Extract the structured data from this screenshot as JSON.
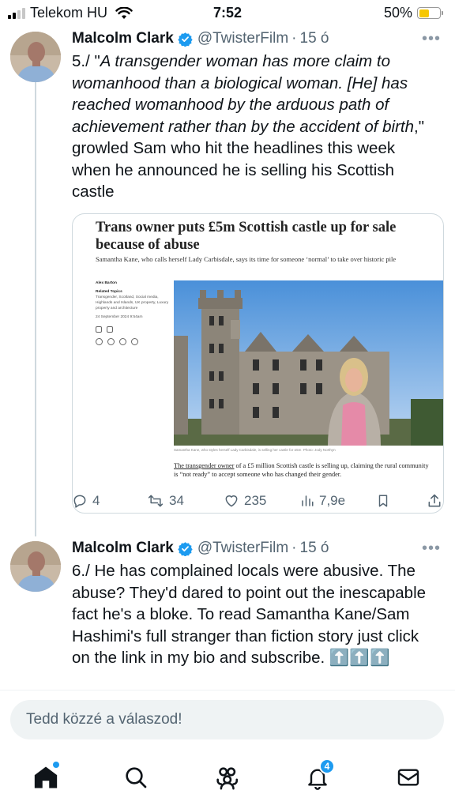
{
  "status_bar": {
    "carrier": "Telekom HU",
    "time": "7:52",
    "battery_percent": "50%",
    "battery_level": 0.5,
    "signal_bars": 2
  },
  "tweets": [
    {
      "author_name": "Malcolm Clark",
      "handle": "@TwisterFilm",
      "separator": "·",
      "age": "15 ó",
      "text_prefix": "5./ \"",
      "text_italic": "A transgender woman has more claim to womanhood than a biological woman. [He] has reached womanhood by the arduous path of achievement rather than by the accident of birth",
      "text_suffix": ",\" growled Sam who hit the headlines this week when he announced he is selling his Scottish castle",
      "card": {
        "headline": "Trans owner puts £5m Scottish castle up for sale because of abuse",
        "subheadline": "Samantha Kane, who calls herself Lady Carbisdale, says its time for someone ‘normal’ to take over historic pile",
        "author": "Alex Barton",
        "related_topics_label": "Related Topics",
        "related_topics": "Transgender, Scotland, Social media, Highlands and Islands, UK property, Luxury property and architecture",
        "date": "24 September 2024 9:54am",
        "photo_caption": "Samantha Kane, who styles herself Lady Carbisdale, is selling her castle for £5m",
        "photo_credit": "Photo: Jody Northyn",
        "excerpt_link": "The transgender owner",
        "excerpt_rest": " of a £5 million Scottish castle is selling up, claiming the rural community is “not ready” to accept someone who has changed their gender."
      },
      "stats": {
        "replies": "4",
        "reposts": "34",
        "likes": "235",
        "views": "7,9e"
      }
    },
    {
      "author_name": "Malcolm Clark",
      "handle": "@TwisterFilm",
      "separator": "·",
      "age": "15 ó",
      "text": "6./ He has complained locals were abusive. The abuse? They'd dared to point out the inescapable fact he's a bloke. To read Samantha Kane/Sam Hashimi's full stranger than fiction story just click on the link in my bio and subscribe.",
      "emoji": "⬆️⬆️⬆️"
    }
  ],
  "composer": {
    "placeholder": "Tedd közzé a válaszod!"
  },
  "nav": {
    "notification_count": "4",
    "items": [
      "home-icon",
      "search-icon",
      "communities-icon",
      "notifications-icon",
      "messages-icon"
    ]
  },
  "colors": {
    "accent": "#1d9bf0",
    "text": "#0f1419",
    "muted": "#536471",
    "border": "#cfd9de",
    "battery": "#f6c700"
  }
}
